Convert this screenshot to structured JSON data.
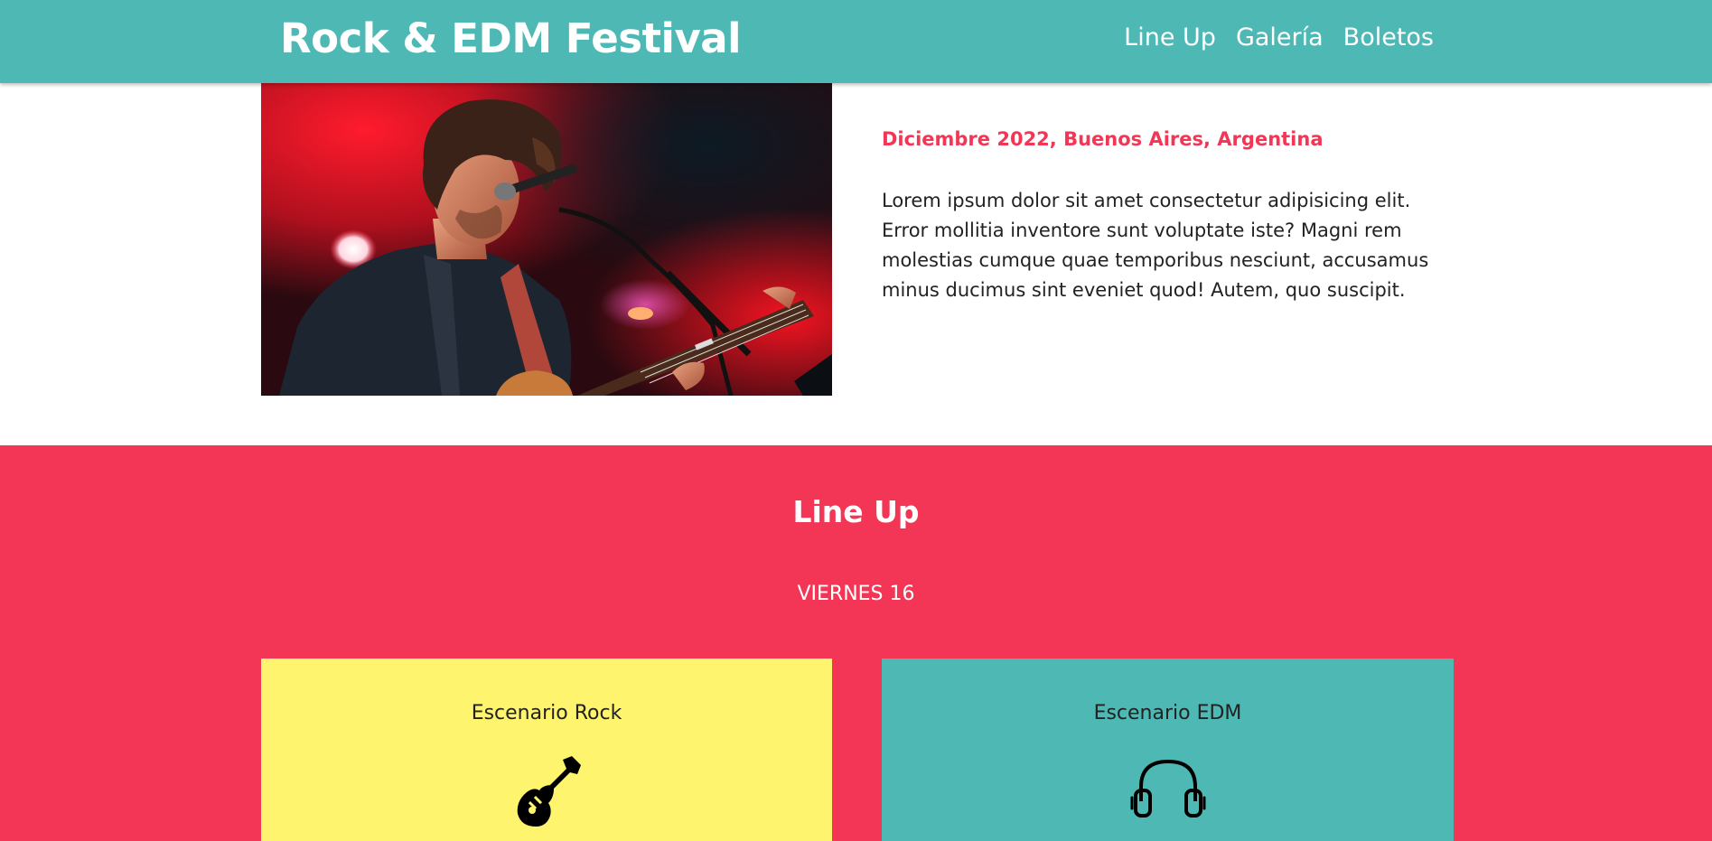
{
  "header": {
    "logo": "Rock & EDM Festival",
    "nav": [
      "Line Up",
      "Galería",
      "Boletos"
    ]
  },
  "hero": {
    "date": "Diciembre 2022, Buenos Aires, Argentina",
    "text": "Lorem ipsum dolor sit amet consectetur adipisicing elit. Error mollitia inventore sunt voluptate iste? Magni rem molestias cumque quae temporibus nesciunt, accusamus minus ducimus sint eveniet quod! Autem, quo suscipit."
  },
  "lineup": {
    "title": "Line Up",
    "day": "VIERNES 16",
    "stages": [
      {
        "name": "Escenario Rock",
        "icon": "guitar-icon"
      },
      {
        "name": "Escenario EDM",
        "icon": "headphones-icon"
      }
    ]
  },
  "colors": {
    "teal": "#4db8b4",
    "red": "#f33655",
    "yellow": "#fff46e"
  }
}
